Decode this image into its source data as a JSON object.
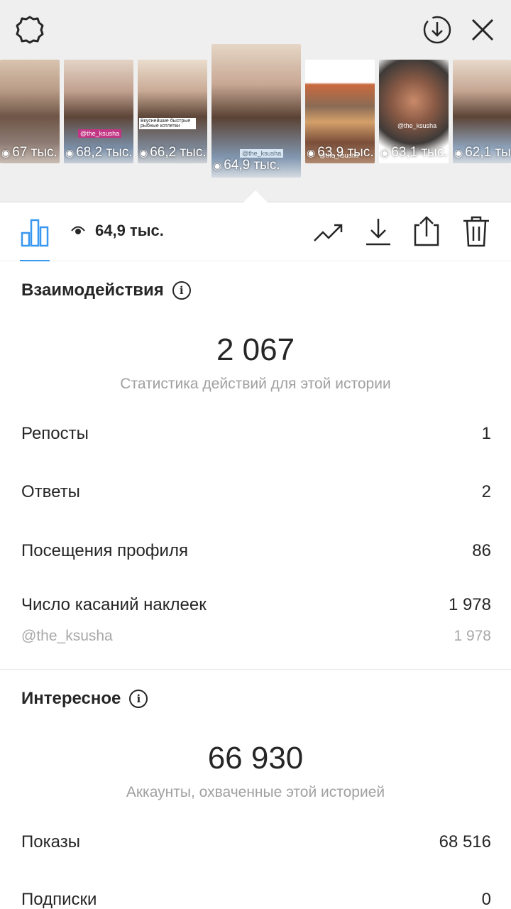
{
  "top": {
    "icons": [
      "settings-gear-icon",
      "download-circle-icon",
      "close-icon"
    ]
  },
  "thumbnails": [
    {
      "views": "67 тыс.",
      "caption": ""
    },
    {
      "views": "68,2 тыс.",
      "caption": "@the_ksusha"
    },
    {
      "views": "66,2 тыс.",
      "caption": "Вкуснейшие быстрые рыбные котлетки"
    },
    {
      "views": "64,9 тыс.",
      "caption": "@the_ksusha"
    },
    {
      "views": "63,9 тыс.",
      "caption": "@the_ksusha"
    },
    {
      "views": "63,1 тыс.",
      "caption": "@the_ksusha"
    },
    {
      "views": "62,1 тыс.",
      "caption": ""
    }
  ],
  "toolbar": {
    "views": "64,9 тыс.",
    "icons": [
      "bar-chart-icon",
      "eye-icon",
      "trending-icon",
      "download-icon",
      "share-icon",
      "trash-icon"
    ]
  },
  "interactions": {
    "title": "Взаимодействия",
    "total": "2 067",
    "subtitle": "Статистика действий для этой истории",
    "rows": [
      {
        "label": "Репосты",
        "value": "1"
      },
      {
        "label": "Ответы",
        "value": "2"
      },
      {
        "label": "Посещения профиля",
        "value": "86"
      },
      {
        "label": "Число касаний наклеек",
        "value": "1 978"
      }
    ],
    "sticker": {
      "label": "@the_ksusha",
      "value": "1 978"
    }
  },
  "discovery": {
    "title": "Интересное",
    "total": "66 930",
    "subtitle": "Аккаунты, охваченные этой историей",
    "rows": [
      {
        "label": "Показы",
        "value": "68 516"
      },
      {
        "label": "Подписки",
        "value": "0"
      }
    ]
  },
  "colors": {
    "accent": "#3897f0",
    "text": "#262626",
    "muted": "#a0a0a0"
  }
}
